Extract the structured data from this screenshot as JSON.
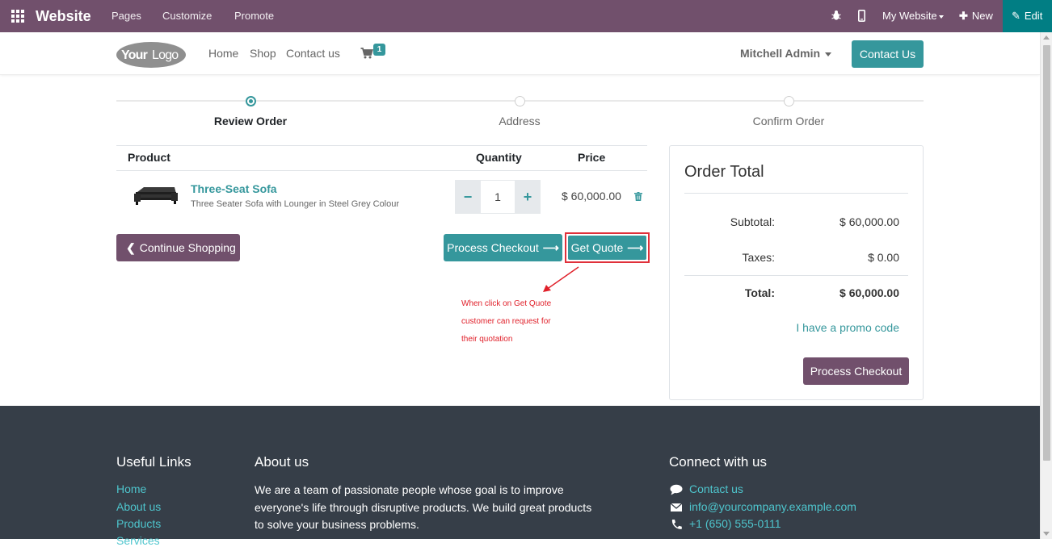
{
  "topbar": {
    "brand": "Website",
    "menu": [
      "Pages",
      "Customize",
      "Promote"
    ],
    "my_website": "My Website",
    "new_label": "New",
    "edit_label": "Edit",
    "bar_color": "#71506c",
    "edit_color": "#017e84"
  },
  "header": {
    "logo_text": "YourLogo",
    "nav": [
      "Home",
      "Shop",
      "Contact us"
    ],
    "cart_count": "1",
    "user": "Mitchell Admin",
    "contact_button": "Contact Us",
    "accent": "#35979c"
  },
  "steps": [
    {
      "label": "Review Order",
      "active": true
    },
    {
      "label": "Address",
      "active": false
    },
    {
      "label": "Confirm Order",
      "active": false
    }
  ],
  "cart": {
    "headers": {
      "product": "Product",
      "quantity": "Quantity",
      "price": "Price"
    },
    "rows": [
      {
        "name": "Three-Seat Sofa",
        "description": "Three Seater Sofa with Lounger in Steel Grey Colour",
        "quantity": "1",
        "price": "$ 60,000.00"
      }
    ],
    "continue_button": "Continue Shopping",
    "process_button": "Process Checkout",
    "quote_button": "Get Quote",
    "annotation_lines": [
      "When click on Get Quote",
      "customer can request for",
      "their quotation"
    ]
  },
  "summary": {
    "title": "Order Total",
    "subtotal_label": "Subtotal:",
    "subtotal_value": "$ 60,000.00",
    "taxes_label": "Taxes:",
    "taxes_value": "$ 0.00",
    "total_label": "Total:",
    "total_value": "$ 60,000.00",
    "promo_link": "I have a promo code",
    "checkout_button": "Process Checkout",
    "secondary_color": "#71506c"
  },
  "footer": {
    "useful_links_title": "Useful Links",
    "links": [
      "Home",
      "About us",
      "Products",
      "Services"
    ],
    "about_title": "About us",
    "about_text": "We are a team of passionate people whose goal is to improve everyone's life through disruptive products. We build great products to solve your business problems.",
    "connect_title": "Connect with us",
    "contact_link": "Contact us",
    "email": "info@yourcompany.example.com",
    "phone": "+1 (650) 555-0111",
    "bg_color": "#363e48",
    "link_color": "#4ec5cd"
  }
}
